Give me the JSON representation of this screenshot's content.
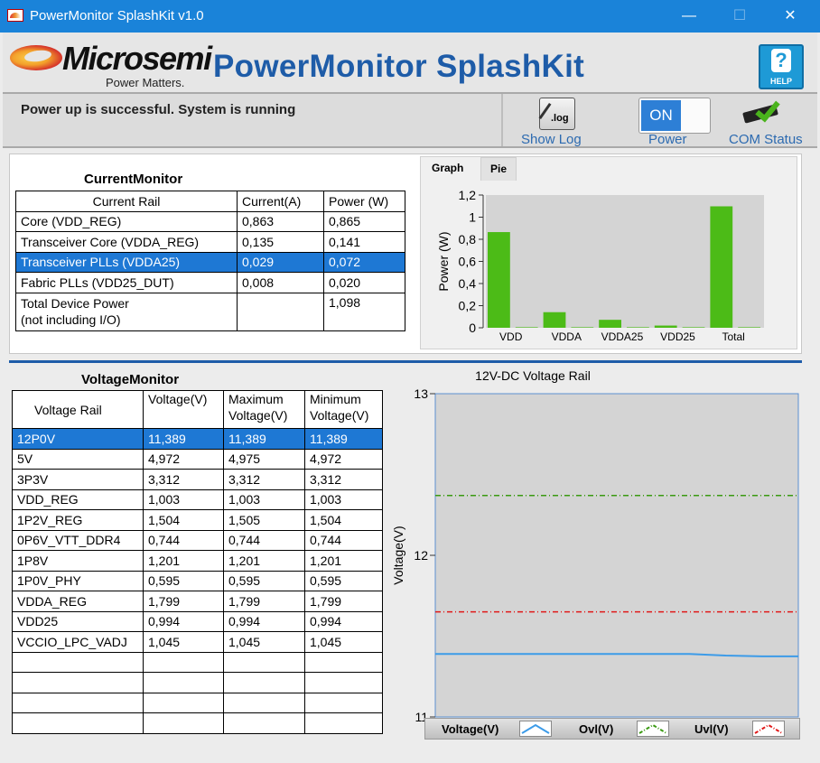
{
  "window": {
    "title": "PowerMonitor SplashKit v1.0",
    "minimize": "—",
    "maximize": "☐",
    "close": "✕"
  },
  "header": {
    "brand": "Microsemi",
    "tagline": "Power Matters.",
    "app_title": "PowerMonitor SplashKit",
    "help_label": "HELP",
    "help_glyph": "?"
  },
  "status": {
    "message": "Power up is successful. System is running",
    "show_log_label": "Show Log",
    "log_icon_text": ".log",
    "power_label": "Power",
    "power_state": "ON",
    "com_label": "COM Status"
  },
  "current_monitor": {
    "title": "CurrentMonitor",
    "columns": [
      "Current Rail",
      "Current(A)",
      "Power (W)"
    ],
    "rows": [
      [
        "Core (VDD_REG)",
        "0,863",
        "0,865"
      ],
      [
        "Transceiver Core (VDDA_REG)",
        "0,135",
        "0,141"
      ],
      [
        "Transceiver PLLs (VDDA25)",
        "0,029",
        "0,072"
      ],
      [
        "Fabric PLLs (VDD25_DUT)",
        "0,008",
        "0,020"
      ]
    ],
    "total_label_1": "Total Device Power",
    "total_label_2": "(not including I/O)",
    "total_value": "1,098",
    "selected_row": 2
  },
  "graph_tabs": {
    "graph": "Graph",
    "pie": "Pie"
  },
  "voltage_monitor": {
    "title": "VoltageMonitor",
    "columns": [
      "Voltage Rail",
      "Voltage(V)",
      "Maximum Voltage(V)",
      "Minimum Voltage(V)"
    ],
    "col_lines": [
      [
        "Voltage Rail"
      ],
      [
        "Voltage(V)"
      ],
      [
        "Maximum",
        "Voltage(V)"
      ],
      [
        "Minimum",
        "Voltage(V)"
      ]
    ],
    "rows": [
      [
        "12P0V",
        "11,389",
        "11,389",
        "11,389"
      ],
      [
        "5V",
        "4,972",
        "4,975",
        "4,972"
      ],
      [
        "3P3V",
        "3,312",
        "3,312",
        "3,312"
      ],
      [
        "VDD_REG",
        "1,003",
        "1,003",
        "1,003"
      ],
      [
        "1P2V_REG",
        "1,504",
        "1,505",
        "1,504"
      ],
      [
        "0P6V_VTT_DDR4",
        "0,744",
        "0,744",
        "0,744"
      ],
      [
        "1P8V",
        "1,201",
        "1,201",
        "1,201"
      ],
      [
        "1P0V_PHY",
        "0,595",
        "0,595",
        "0,595"
      ],
      [
        "VDDA_REG",
        "1,799",
        "1,799",
        "1,799"
      ],
      [
        "VDD25",
        "0,994",
        "0,994",
        "0,994"
      ],
      [
        "VCCIO_LPC_VADJ",
        "1,045",
        "1,045",
        "1,045"
      ]
    ],
    "empty_rows": 4,
    "selected_row": 0
  },
  "colors": {
    "accent": "#1e78d4",
    "bar": "#4cbb17",
    "voltage_line": "#3c9be8",
    "ovl_line": "#3a9a12",
    "uvl_line": "#e01818",
    "plot_bg": "#d4d4d4"
  },
  "chart_data": [
    {
      "type": "bar",
      "categories": [
        "VDD",
        "",
        "VDDA",
        "",
        "VDDA25",
        "",
        "VDD25",
        "",
        "Total",
        ""
      ],
      "values": [
        0.865,
        0.005,
        0.141,
        0.005,
        0.072,
        0.005,
        0.02,
        0.005,
        1.098,
        0.005
      ],
      "title": "",
      "xlabel": "",
      "ylabel": "Power (W)",
      "ylim": [
        0,
        1.2
      ],
      "yticks": [
        "0",
        "0,2",
        "0,4",
        "0,6",
        "0,8",
        "1",
        "1,2"
      ],
      "xtick_labels": [
        "VDD",
        "VDDA",
        "VDDA25",
        "VDD25",
        "Total"
      ]
    },
    {
      "type": "line",
      "title": "12V-DC Voltage Rail",
      "ylabel": "Voltage(V)",
      "ylim": [
        11,
        13
      ],
      "yticks": [
        "11",
        "12",
        "13"
      ],
      "series": [
        {
          "name": "Voltage(V)",
          "x": [
            0,
            10,
            20,
            30,
            40,
            50,
            60,
            70,
            80,
            90,
            100
          ],
          "values": [
            11.39,
            11.39,
            11.39,
            11.39,
            11.39,
            11.39,
            11.39,
            11.39,
            11.38,
            11.375,
            11.375
          ]
        },
        {
          "name": "Ovl(V)",
          "x": [
            0,
            100
          ],
          "values": [
            12.37,
            12.37
          ]
        },
        {
          "name": "Uvl(V)",
          "x": [
            0,
            100
          ],
          "values": [
            11.65,
            11.65
          ]
        }
      ],
      "legend": "bottom"
    }
  ]
}
